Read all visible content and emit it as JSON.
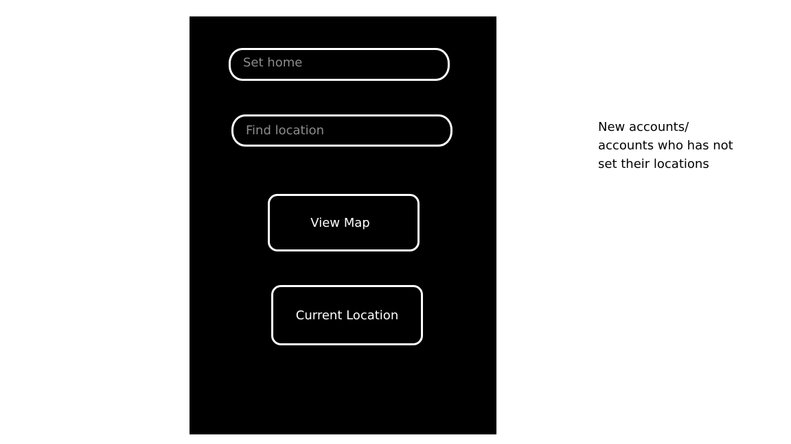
{
  "screen": {
    "set_home_placeholder": "Set home",
    "find_location_placeholder": "Find location",
    "view_map_label": "View Map",
    "current_location_label": "Current Location"
  },
  "annotation": {
    "text": "New accounts/\naccounts who has not\nset their locations"
  },
  "colors": {
    "screen_bg": "#000000",
    "outline": "#ffffff",
    "placeholder": "#8c8c8c"
  }
}
